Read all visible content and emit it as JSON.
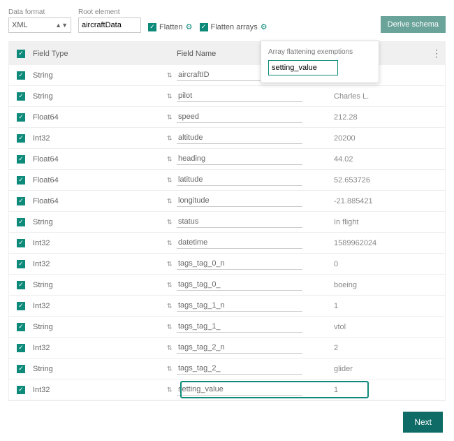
{
  "labels": {
    "dataFormat": "Data format",
    "rootElement": "Root element",
    "flatten": "Flatten",
    "flattenArrays": "Flatten arrays",
    "derive": "Derive schema",
    "next": "Next",
    "popupTitle": "Array flattening exemptions",
    "popupValue": "setting_value"
  },
  "form": {
    "dataFormat": "XML",
    "rootElement": "aircraftData"
  },
  "headers": {
    "fieldType": "Field Type",
    "fieldName": "Field Name"
  },
  "rows": [
    {
      "type": "String",
      "name": "aircraftID",
      "value": ""
    },
    {
      "type": "String",
      "name": "pilot",
      "value": "Charles L."
    },
    {
      "type": "Float64",
      "name": "speed",
      "value": "212.28"
    },
    {
      "type": "Int32",
      "name": "altitude",
      "value": "20200"
    },
    {
      "type": "Float64",
      "name": "heading",
      "value": "44.02"
    },
    {
      "type": "Float64",
      "name": "latitude",
      "value": "52.653726"
    },
    {
      "type": "Float64",
      "name": "longitude",
      "value": "-21.885421"
    },
    {
      "type": "String",
      "name": "status",
      "value": "In flight"
    },
    {
      "type": "Int32",
      "name": "datetime",
      "value": "1589962024"
    },
    {
      "type": "Int32",
      "name": "tags_tag_0_n",
      "value": "0"
    },
    {
      "type": "String",
      "name": "tags_tag_0_",
      "value": "boeing"
    },
    {
      "type": "Int32",
      "name": "tags_tag_1_n",
      "value": "1"
    },
    {
      "type": "String",
      "name": "tags_tag_1_",
      "value": "vtol"
    },
    {
      "type": "Int32",
      "name": "tags_tag_2_n",
      "value": "2"
    },
    {
      "type": "String",
      "name": "tags_tag_2_",
      "value": "glider"
    },
    {
      "type": "Int32",
      "name": "setting_value",
      "value": "1"
    }
  ]
}
